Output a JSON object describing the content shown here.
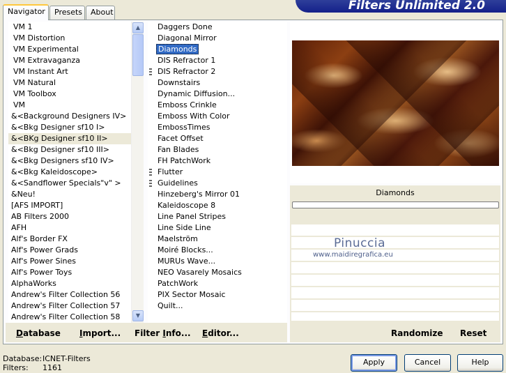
{
  "tabs": [
    {
      "label": "Navigator",
      "active": true
    },
    {
      "label": "Presets",
      "active": false
    },
    {
      "label": "About",
      "active": false
    }
  ],
  "banner": {
    "title": "Filters Unlimited 2.0"
  },
  "categories": [
    "VM 1",
    "VM Distortion",
    "VM Experimental",
    "VM Extravaganza",
    "VM Instant Art",
    "VM Natural",
    "VM Toolbox",
    "VM",
    "&<Background Designers IV>",
    "&<Bkg Designer sf10 I>",
    "&<BKg Designer sf10 II>",
    "&<Bkg Designer sf10 III>",
    "&<Bkg Designers sf10 IV>",
    "&<Bkg Kaleidoscope>",
    "&<Sandflower Specials\"v\" >",
    "&Neu!",
    "[AFS IMPORT]",
    "AB Filters 2000",
    "AFH",
    "Alf's Border FX",
    "Alf's Power Grads",
    "Alf's Power Sines",
    "Alf's Power Toys",
    "AlphaWorks",
    "Andrew's Filter Collection 56",
    "Andrew's Filter Collection 57",
    "Andrew's Filter Collection 58"
  ],
  "selected_category": "&<BKg Designer sf10 II>",
  "filters": [
    {
      "label": "Daggers Done",
      "grip": false
    },
    {
      "label": "Diagonal Mirror",
      "grip": false
    },
    {
      "label": "Diamonds",
      "grip": false,
      "selected": true
    },
    {
      "label": "DIS Refractor 1",
      "grip": false
    },
    {
      "label": "DIS Refractor 2",
      "grip": true
    },
    {
      "label": "Downstairs",
      "grip": false
    },
    {
      "label": "Dynamic Diffusion...",
      "grip": false
    },
    {
      "label": "Emboss Crinkle",
      "grip": false
    },
    {
      "label": "Emboss With Color",
      "grip": false
    },
    {
      "label": "EmbossTimes",
      "grip": false
    },
    {
      "label": "Facet Offset",
      "grip": false
    },
    {
      "label": "Fan Blades",
      "grip": false
    },
    {
      "label": "FH PatchWork",
      "grip": false
    },
    {
      "label": "Flutter",
      "grip": true
    },
    {
      "label": "Guidelines",
      "grip": true
    },
    {
      "label": "Hinzeberg's Mirror 01",
      "grip": false
    },
    {
      "label": "Kaleidoscope 8",
      "grip": false
    },
    {
      "label": "Line Panel Stripes",
      "grip": false
    },
    {
      "label": "Line Side Line",
      "grip": false
    },
    {
      "label": "Maelström",
      "grip": false
    },
    {
      "label": "Moiré Blocks...",
      "grip": false
    },
    {
      "label": "MURUs Wave...",
      "grip": false
    },
    {
      "label": "NEO Vasarely Mosaics",
      "grip": false
    },
    {
      "label": "PatchWork",
      "grip": false
    },
    {
      "label": "PIX Sector Mosaic",
      "grip": false
    },
    {
      "label": "Quilt...",
      "grip": false
    }
  ],
  "preview": {
    "filter_name": "Diamonds"
  },
  "watermark": {
    "name": "Pinuccia",
    "site": "www.maidiregrafica.eu"
  },
  "links_left": [
    {
      "label": "Database",
      "underline": "D",
      "rest": "atabase"
    },
    {
      "label": "Import...",
      "underline": "I",
      "rest": "mport..."
    },
    {
      "label": "Filter Info...",
      "pre": "Filter ",
      "underline": "I",
      "rest": "nfo..."
    },
    {
      "label": "Editor...",
      "underline": "E",
      "rest": "ditor..."
    }
  ],
  "links_right": {
    "randomize": "Randomize",
    "reset": "Reset"
  },
  "footer": {
    "database_label": "Database:",
    "database_value": "ICNET-Filters",
    "filters_label": "Filters:",
    "filters_value": "1161"
  },
  "buttons": {
    "apply": "Apply",
    "cancel": "Cancel",
    "help": "Help"
  },
  "colors": {
    "selection": "#316ac5",
    "banner": "#1a2a8e",
    "face": "#ece9d8"
  }
}
